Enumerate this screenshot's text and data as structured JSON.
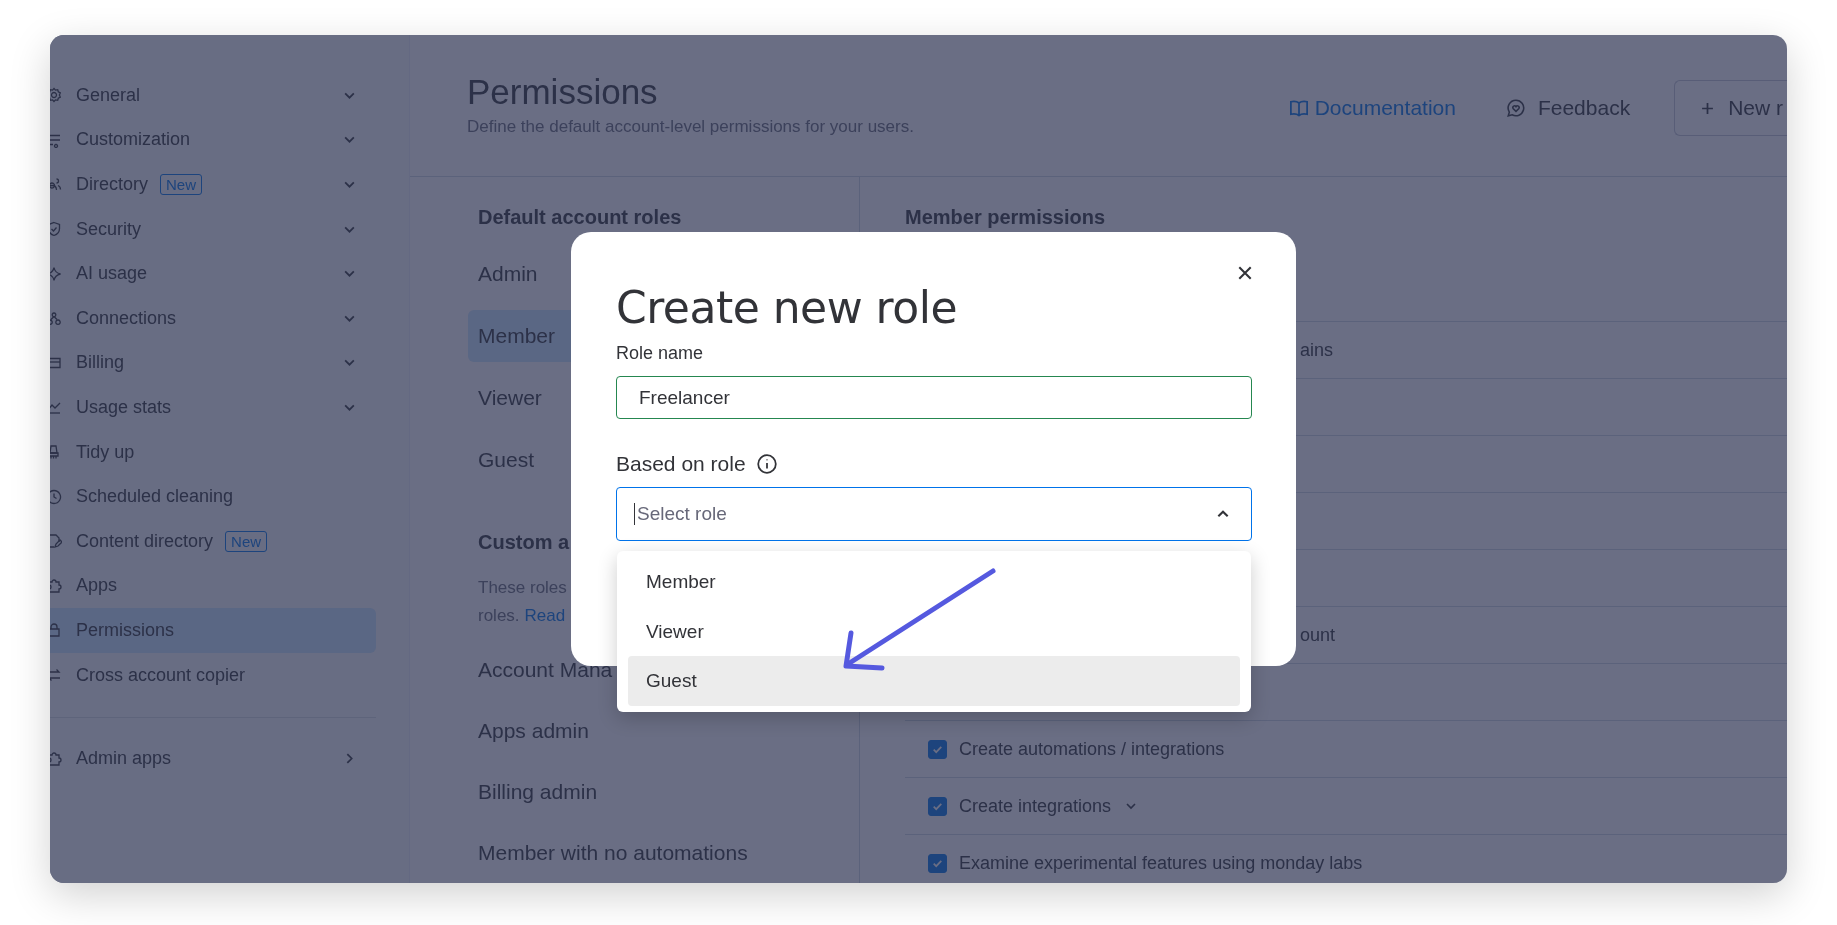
{
  "sidebar": {
    "items": [
      {
        "label": "General",
        "expandable": true,
        "selected": false
      },
      {
        "label": "Customization",
        "expandable": true,
        "selected": false
      },
      {
        "label": "Directory",
        "badge": "New",
        "expandable": true,
        "selected": false
      },
      {
        "label": "Security",
        "expandable": true,
        "selected": false
      },
      {
        "label": "AI usage",
        "expandable": true,
        "selected": false
      },
      {
        "label": "Connections",
        "expandable": true,
        "selected": false
      },
      {
        "label": "Billing",
        "expandable": true,
        "selected": false
      },
      {
        "label": "Usage stats",
        "expandable": true,
        "selected": false
      },
      {
        "label": "Tidy up",
        "expandable": false,
        "selected": false
      },
      {
        "label": "Scheduled cleaning",
        "expandable": false,
        "selected": false
      },
      {
        "label": "Content directory",
        "badge": "New",
        "expandable": false,
        "selected": false
      },
      {
        "label": "Apps",
        "expandable": false,
        "selected": false
      },
      {
        "label": "Permissions",
        "expandable": false,
        "selected": true
      },
      {
        "label": "Cross account copier",
        "expandable": false,
        "selected": false
      }
    ],
    "footer_items": [
      {
        "label": "Admin apps",
        "has_submenu": true,
        "selected": false
      }
    ]
  },
  "header": {
    "title": "Permissions",
    "subtitle": "Define the default account-level permissions for your users.",
    "documentation_link": "Documentation",
    "feedback_button": "Feedback",
    "new_role_button": "New r"
  },
  "default_roles": {
    "heading": "Default account roles",
    "roles": [
      {
        "label": "Admin",
        "selected": false
      },
      {
        "label": "Member",
        "selected": true
      },
      {
        "label": "Viewer",
        "selected": false
      },
      {
        "label": "Guest",
        "selected": false
      }
    ]
  },
  "custom_roles": {
    "heading": "Custom a",
    "description_lines": [
      "These roles",
      "roles."
    ],
    "read_link": "Read",
    "roles": [
      "Account Mana",
      "Apps admin",
      "Billing admin",
      "Member with no automations"
    ]
  },
  "member_permissions": {
    "heading": "Member permissions",
    "rows": [
      {
        "kind": "clipped",
        "text": "ains"
      },
      {
        "kind": "blank"
      },
      {
        "kind": "blank"
      },
      {
        "kind": "blank"
      },
      {
        "kind": "blank"
      },
      {
        "kind": "clipped",
        "text": "ount"
      },
      {
        "kind": "blank"
      },
      {
        "kind": "checkbox",
        "text": "Create automations / integrations",
        "checked": true,
        "caret": false
      },
      {
        "kind": "checkbox",
        "text": "Create integrations",
        "checked": true,
        "caret": true
      },
      {
        "kind": "checkbox",
        "text": "Examine experimental features using monday labs",
        "checked": true,
        "caret": false
      }
    ]
  },
  "modal": {
    "title": "Create new role",
    "role_name": {
      "label": "Role name",
      "value": "Freelancer"
    },
    "based_on": {
      "label": "Based on role",
      "placeholder": "Select role",
      "expanded": true,
      "options": [
        {
          "label": "Member",
          "selected": false
        },
        {
          "label": "Viewer",
          "selected": false
        },
        {
          "label": "Guest",
          "selected": true
        }
      ]
    }
  }
}
